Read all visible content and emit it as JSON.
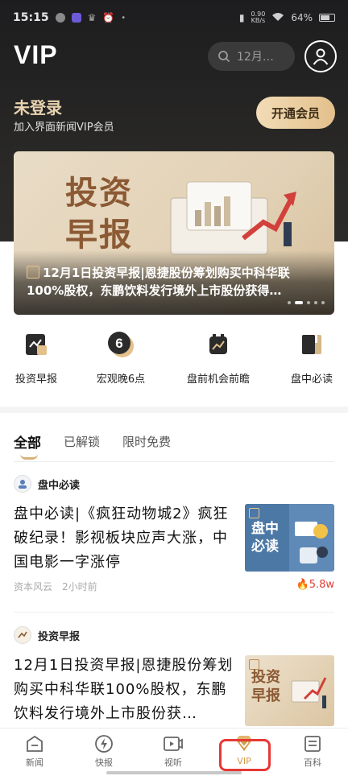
{
  "status_bar": {
    "time": "15:15",
    "net_speed_top": "0.90",
    "net_speed_bottom": "KB/s",
    "battery": "64%"
  },
  "header": {
    "title": "VIP",
    "search_placeholder": "12月…",
    "login_title": "未登录",
    "login_sub": "加入界面新闻VIP会员",
    "open_vip": "开通会员"
  },
  "banner": {
    "big_text_line1": "投资",
    "big_text_line2": "早报",
    "caption": "12月1日投资早报|恩捷股份筹划购买中科华联100%股权，东鹏饮料发行境外上市股份获得…",
    "active_dot": 1,
    "dot_count": 5
  },
  "quick_links": [
    {
      "label": "投资早报",
      "icon": "chart-up-icon"
    },
    {
      "label": "宏观晚6点",
      "icon": "six-circle-icon"
    },
    {
      "label": "盘前机会前瞻",
      "icon": "alarm-chart-icon"
    },
    {
      "label": "盘中必读",
      "icon": "book-icon"
    }
  ],
  "tabs": [
    "全部",
    "已解锁",
    "限时免费"
  ],
  "articles": [
    {
      "source": "盘中必读",
      "title": "盘中必读|《疯狂动物城2》疯狂破纪录！影视板块应声大涨，中国电影一字涨停",
      "thumb_text": "盘中必读",
      "author": "资本风云",
      "time": "2小时前",
      "hot": "5.8w"
    },
    {
      "source": "投资早报",
      "title": "12月1日投资早报|恩捷股份筹划购买中科华联100%股权，东鹏饮料发行境外上市股份获…",
      "thumb_text": "投资早报"
    }
  ],
  "bottom_nav": [
    {
      "label": "新闻",
      "icon": "news-icon"
    },
    {
      "label": "快报",
      "icon": "flash-icon"
    },
    {
      "label": "视听",
      "icon": "video-icon"
    },
    {
      "label": "VIP",
      "icon": "vip-diamond-icon"
    },
    {
      "label": "百科",
      "icon": "encyclopedia-icon"
    }
  ],
  "colors": {
    "gold": "#e3c08c",
    "accent_text": "#d39a4a",
    "hot_red": "#e0403a",
    "highlight_red": "#e53935"
  }
}
